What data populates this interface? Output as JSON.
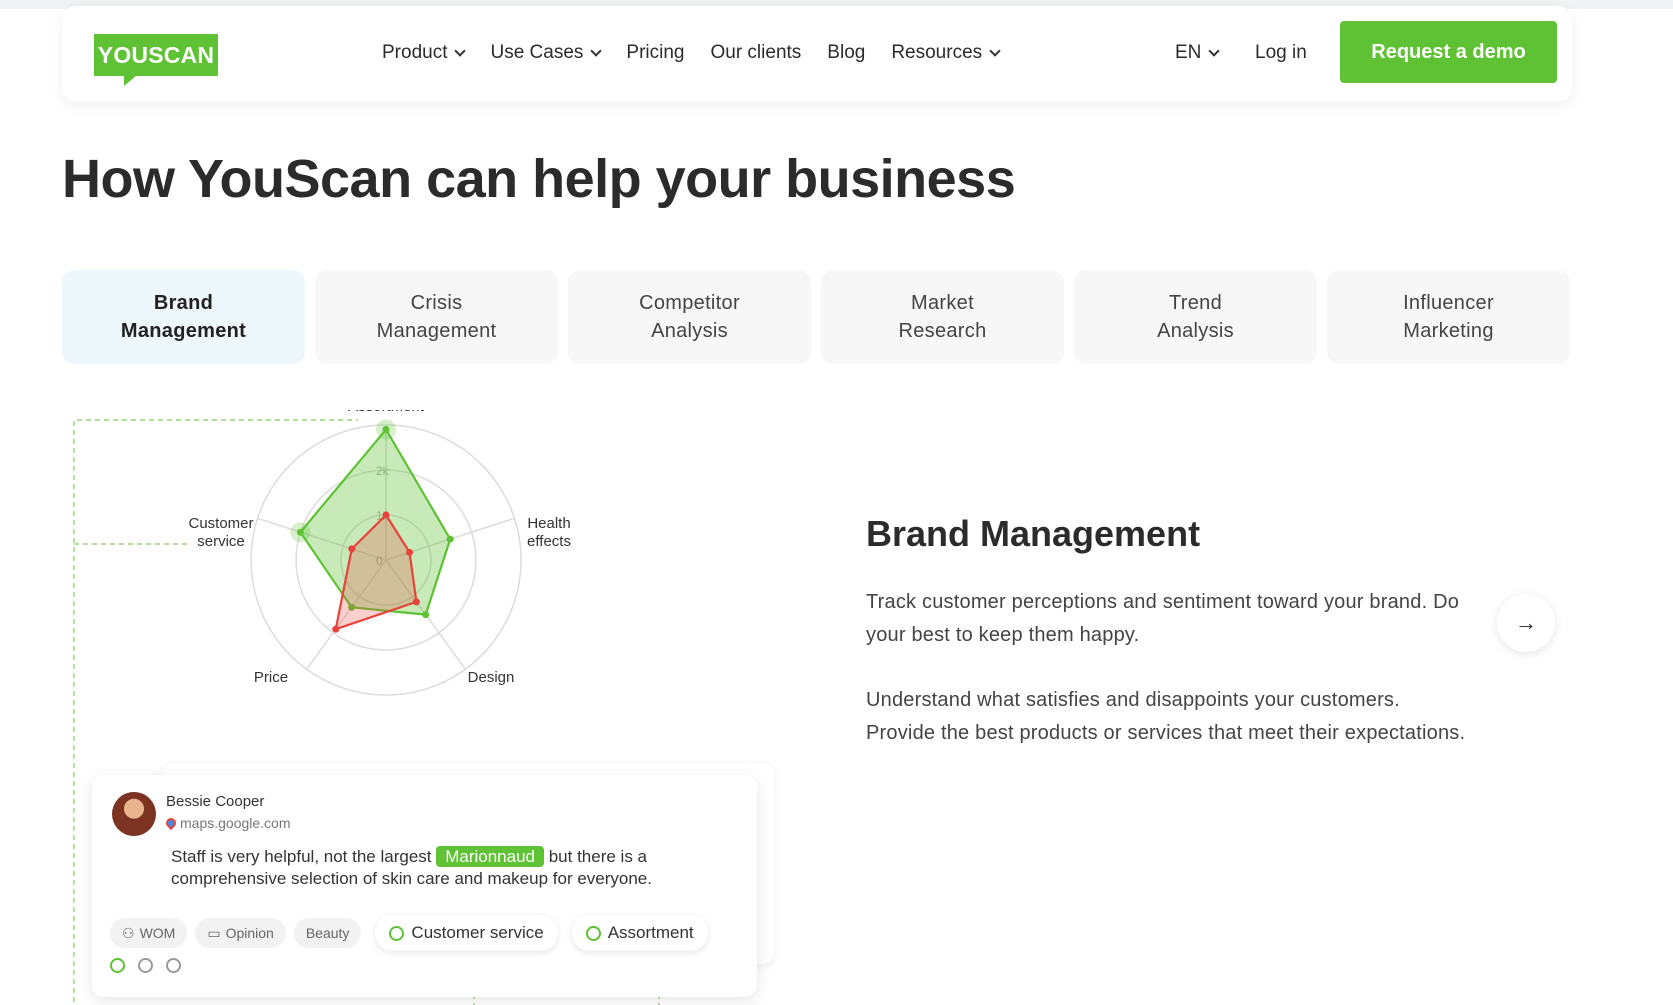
{
  "header": {
    "logo": "YOUSCAN",
    "nav": [
      {
        "label": "Product",
        "dropdown": true
      },
      {
        "label": "Use Cases",
        "dropdown": true
      },
      {
        "label": "Pricing",
        "dropdown": false
      },
      {
        "label": "Our clients",
        "dropdown": false
      },
      {
        "label": "Blog",
        "dropdown": false
      },
      {
        "label": "Resources",
        "dropdown": true
      }
    ],
    "language": "EN",
    "login": "Log in",
    "cta": "Request a demo"
  },
  "page_title": "How YouScan can help your business",
  "tabs": [
    {
      "line1": "Brand",
      "line2": "Management",
      "active": true
    },
    {
      "line1": "Crisis",
      "line2": "Management",
      "active": false
    },
    {
      "line1": "Competitor",
      "line2": "Analysis",
      "active": false
    },
    {
      "line1": "Market",
      "line2": "Research",
      "active": false
    },
    {
      "line1": "Trend",
      "line2": "Analysis",
      "active": false
    },
    {
      "line1": "Influencer",
      "line2": "Marketing",
      "active": false
    }
  ],
  "radar": {
    "axes": [
      "Assortment",
      "Health effects",
      "Design",
      "Price",
      "Customer service"
    ],
    "ticks": [
      "0",
      "1k",
      "2k"
    ],
    "max": 3000,
    "colors": {
      "green": "#5ec234",
      "red": "#e9423a"
    },
    "series": [
      {
        "values": [
          2900,
          1500,
          1500,
          1300,
          2000
        ]
      },
      {
        "values": [
          1000,
          550,
          1150,
          1900,
          800
        ]
      }
    ]
  },
  "mention": {
    "author": "Bessie Cooper",
    "source": "maps.google.com",
    "text_before": "Staff is very helpful, not the largest ",
    "highlight": "Marionnaud",
    "text_after": " but there is a comprehensive selection of skin care and makeup for everyone.",
    "chips": [
      "WOM",
      "Opinion",
      "Beauty"
    ],
    "topics": [
      "Customer service",
      "Assortment"
    ]
  },
  "panel": {
    "title": "Brand Management",
    "p1": "Track customer perceptions and sentiment toward your brand. Do your best to keep them happy.",
    "p2": "Understand what satisfies and disappoints your customers. Provide the best products or services that meet their expectations.",
    "next_icon": "→"
  }
}
